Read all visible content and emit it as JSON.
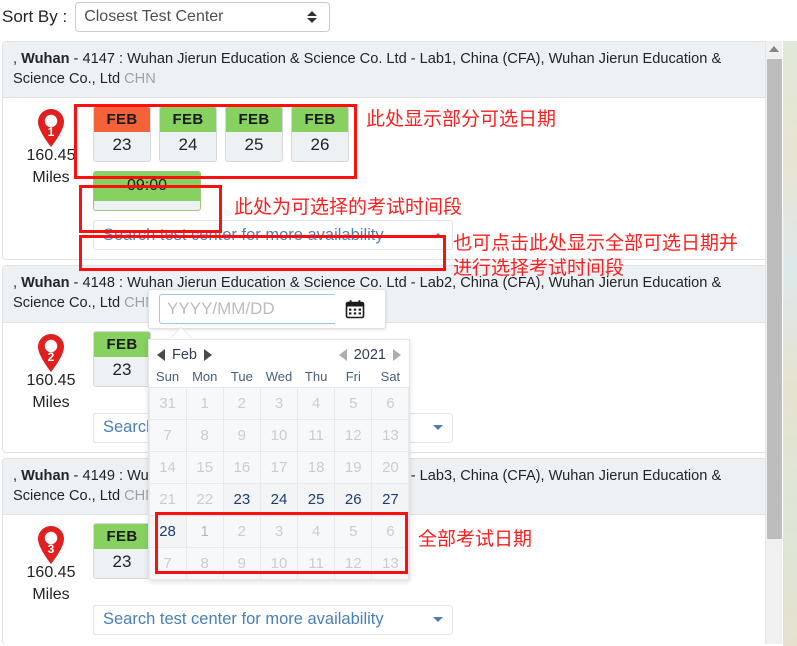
{
  "sort": {
    "label": "Sort By :",
    "value": "Closest Test Center"
  },
  "centers": [
    {
      "pin": "1",
      "distance": "160.45",
      "distance_unit": "Miles",
      "name_prefix": ", ",
      "city": "Wuhan",
      "dash": " - ",
      "code": "4147",
      "description": " : Wuhan Jierun Education & Science Co. Ltd - Lab1, China (CFA), Wuhan Jierun Education & Science Co., Ltd ",
      "country": "CHN",
      "dates": [
        {
          "month": "FEB",
          "day": "23",
          "state": "selected"
        },
        {
          "month": "FEB",
          "day": "24",
          "state": "available"
        },
        {
          "month": "FEB",
          "day": "25",
          "state": "available"
        },
        {
          "month": "FEB",
          "day": "26",
          "state": "available"
        }
      ],
      "times": [
        {
          "time": "09:00",
          "state": "available"
        }
      ],
      "search_label": "Search test center for more availability",
      "search_expanded": true
    },
    {
      "pin": "2",
      "distance": "160.45",
      "distance_unit": "Miles",
      "name_prefix": ", ",
      "city": "Wuhan",
      "dash": " - ",
      "code": "4148",
      "description": " : Wuhan Jierun Education & Science Co. Ltd - Lab2, China (CFA), Wuhan Jierun Education & Science Co., Ltd ",
      "country": "CHN",
      "dates": [
        {
          "month": "FEB",
          "day": "23",
          "state": "available"
        }
      ],
      "times": [],
      "search_label": "Search test center for more availability",
      "search_expanded": false
    },
    {
      "pin": "3",
      "distance": "160.45",
      "distance_unit": "Miles",
      "name_prefix": ", ",
      "city": "Wuhan",
      "dash": " - ",
      "code": "4149",
      "description": " : Wuhan Jierun Education & Science Co. Ltd - Lab3, China (CFA), Wuhan Jierun Education & Science Co., Ltd ",
      "country": "CHN",
      "dates": [
        {
          "month": "FEB",
          "day": "23",
          "state": "available"
        }
      ],
      "times": [],
      "search_label": "Search test center for more availability",
      "search_expanded": false
    }
  ],
  "datepicker": {
    "input_placeholder": "YYYY/MM/DD",
    "input_value": "",
    "calendar_icon": "calendar-icon",
    "month": "Feb",
    "year": "2021",
    "prev_month_icon": "chevron-left-icon",
    "next_month_icon": "chevron-right-icon",
    "prev_year_icon": "chevron-left-icon",
    "next_year_icon": "chevron-right-icon",
    "weekdays": [
      "Sun",
      "Mon",
      "Tue",
      "Wed",
      "Thu",
      "Fri",
      "Sat"
    ],
    "weeks": [
      [
        {
          "d": "31",
          "on": false
        },
        {
          "d": "1",
          "on": false
        },
        {
          "d": "2",
          "on": false
        },
        {
          "d": "3",
          "on": false
        },
        {
          "d": "4",
          "on": false
        },
        {
          "d": "5",
          "on": false
        },
        {
          "d": "6",
          "on": false
        }
      ],
      [
        {
          "d": "7",
          "on": false
        },
        {
          "d": "8",
          "on": false
        },
        {
          "d": "9",
          "on": false
        },
        {
          "d": "10",
          "on": false
        },
        {
          "d": "11",
          "on": false
        },
        {
          "d": "12",
          "on": false
        },
        {
          "d": "13",
          "on": false
        }
      ],
      [
        {
          "d": "14",
          "on": false
        },
        {
          "d": "15",
          "on": false
        },
        {
          "d": "16",
          "on": false
        },
        {
          "d": "17",
          "on": false
        },
        {
          "d": "18",
          "on": false
        },
        {
          "d": "19",
          "on": false
        },
        {
          "d": "20",
          "on": false
        }
      ],
      [
        {
          "d": "21",
          "on": false
        },
        {
          "d": "22",
          "on": false
        },
        {
          "d": "23",
          "on": true
        },
        {
          "d": "24",
          "on": true
        },
        {
          "d": "25",
          "on": true
        },
        {
          "d": "26",
          "on": true
        },
        {
          "d": "27",
          "on": true
        }
      ],
      [
        {
          "d": "28",
          "on": true
        },
        {
          "d": "1",
          "on": false,
          "mid": true
        },
        {
          "d": "2",
          "on": false
        },
        {
          "d": "3",
          "on": false
        },
        {
          "d": "4",
          "on": false
        },
        {
          "d": "5",
          "on": false
        },
        {
          "d": "6",
          "on": false
        }
      ],
      [
        {
          "d": "7",
          "on": false
        },
        {
          "d": "8",
          "on": false
        },
        {
          "d": "9",
          "on": false
        },
        {
          "d": "10",
          "on": false
        },
        {
          "d": "11",
          "on": false
        },
        {
          "d": "12",
          "on": false
        },
        {
          "d": "13",
          "on": false
        }
      ]
    ]
  },
  "annotations": [
    {
      "id": "partial-dates",
      "text": "此处显示部分可选日期"
    },
    {
      "id": "exam-time-slot",
      "text": "此处为可选择的考试时间段"
    },
    {
      "id": "click-all-dates-line1",
      "text": "也可点击此处显示全部可选日期并"
    },
    {
      "id": "click-all-dates-line2",
      "text": "进行选择考试时间段"
    },
    {
      "id": "all-exam-dates",
      "text": "全部考试日期"
    }
  ],
  "colors": {
    "selected_date": "#f4623a",
    "available_date": "#86d160",
    "annotation": "#fb2020",
    "pin": "#e02020"
  }
}
